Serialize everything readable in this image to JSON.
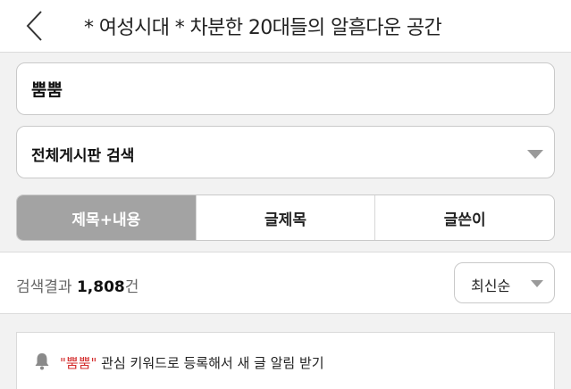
{
  "header": {
    "title": "* 여성시대 * 차분한 20대들의 알흠다운 공간",
    "back_icon": "chevron-left-icon"
  },
  "search": {
    "query": "뿜뿜",
    "board_select": "전체게시판 검색",
    "tabs": [
      {
        "label": "제목+내용",
        "active": true
      },
      {
        "label": "글제목",
        "active": false
      },
      {
        "label": "글쓴이",
        "active": false
      }
    ]
  },
  "results": {
    "label": "검색결과",
    "count": "1,808",
    "unit": "건",
    "sort_label": "최신순"
  },
  "notification": {
    "keyword": "\"뿜뿜\"",
    "message": " 관심 키워드로 등록해서 새 글 알림 받기",
    "icon": "bell-icon"
  },
  "colors": {
    "active_tab": "#a3a3a3",
    "keyword": "#d42d2d",
    "background": "#f2f2f2"
  }
}
